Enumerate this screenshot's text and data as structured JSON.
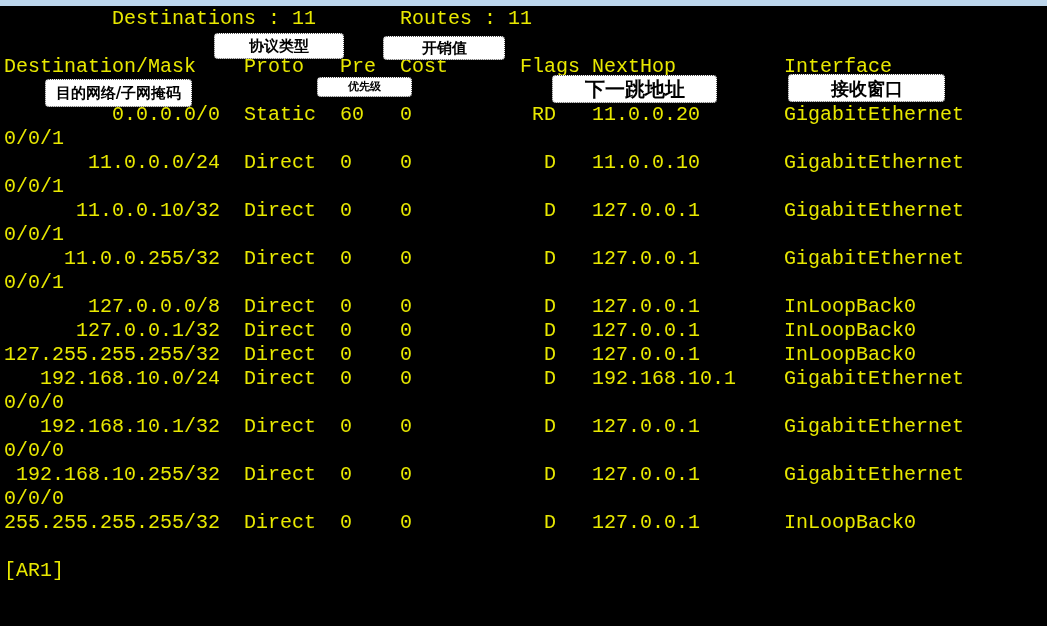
{
  "summary": {
    "destinations": "Destinations : 11",
    "routes": "Routes : 11"
  },
  "columns": [
    "Destination/Mask",
    "Proto",
    "Pre",
    "Cost",
    "Flags",
    "NextHop",
    "Interface"
  ],
  "routes": [
    {
      "destination": "0.0.0.0/0",
      "proto": "Static",
      "pre": "60",
      "cost": "0",
      "flags": "RD",
      "nexthop": "11.0.0.20",
      "interface": "GigabitEthernet",
      "interface_wrap": "0/0/1"
    },
    {
      "destination": "11.0.0.0/24",
      "proto": "Direct",
      "pre": "0",
      "cost": "0",
      "flags": "D",
      "nexthop": "11.0.0.10",
      "interface": "GigabitEthernet",
      "interface_wrap": "0/0/1"
    },
    {
      "destination": "11.0.0.10/32",
      "proto": "Direct",
      "pre": "0",
      "cost": "0",
      "flags": "D",
      "nexthop": "127.0.0.1",
      "interface": "GigabitEthernet",
      "interface_wrap": "0/0/1"
    },
    {
      "destination": "11.0.0.255/32",
      "proto": "Direct",
      "pre": "0",
      "cost": "0",
      "flags": "D",
      "nexthop": "127.0.0.1",
      "interface": "GigabitEthernet",
      "interface_wrap": "0/0/1"
    },
    {
      "destination": "127.0.0.0/8",
      "proto": "Direct",
      "pre": "0",
      "cost": "0",
      "flags": "D",
      "nexthop": "127.0.0.1",
      "interface": "InLoopBack0"
    },
    {
      "destination": "127.0.0.1/32",
      "proto": "Direct",
      "pre": "0",
      "cost": "0",
      "flags": "D",
      "nexthop": "127.0.0.1",
      "interface": "InLoopBack0"
    },
    {
      "destination": "127.255.255.255/32",
      "proto": "Direct",
      "pre": "0",
      "cost": "0",
      "flags": "D",
      "nexthop": "127.0.0.1",
      "interface": "InLoopBack0"
    },
    {
      "destination": "192.168.10.0/24",
      "proto": "Direct",
      "pre": "0",
      "cost": "0",
      "flags": "D",
      "nexthop": "192.168.10.1",
      "interface": "GigabitEthernet",
      "interface_wrap": "0/0/0"
    },
    {
      "destination": "192.168.10.1/32",
      "proto": "Direct",
      "pre": "0",
      "cost": "0",
      "flags": "D",
      "nexthop": "127.0.0.1",
      "interface": "GigabitEthernet",
      "interface_wrap": "0/0/0"
    },
    {
      "destination": "192.168.10.255/32",
      "proto": "Direct",
      "pre": "0",
      "cost": "0",
      "flags": "D",
      "nexthop": "127.0.0.1",
      "interface": "GigabitEthernet",
      "interface_wrap": "0/0/0"
    },
    {
      "destination": "255.255.255.255/32",
      "proto": "Direct",
      "pre": "0",
      "cost": "0",
      "flags": "D",
      "nexthop": "127.0.0.1",
      "interface": "InLoopBack0"
    }
  ],
  "prompt": "[AR1]",
  "callouts": [
    {
      "label": "协议类型"
    },
    {
      "label": "开销值"
    },
    {
      "label": "目的网络/子网掩码"
    },
    {
      "label": "优先级"
    },
    {
      "label": "下一跳地址"
    },
    {
      "label": "接收窗口"
    }
  ]
}
